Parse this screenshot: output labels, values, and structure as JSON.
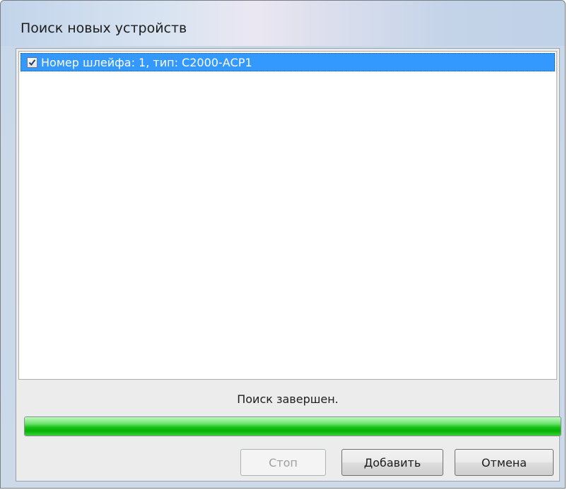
{
  "window": {
    "title": "Поиск новых устройств"
  },
  "list": {
    "items": [
      {
        "label": "Номер шлейфа: 1, тип: С2000-АСР1",
        "checked": true,
        "selected": true
      }
    ]
  },
  "status": {
    "text": "Поиск завершен.",
    "progress_fraction": 1.0
  },
  "buttons": {
    "stop_label": "Стоп",
    "stop_enabled": false,
    "add_label": "Добавить",
    "cancel_label": "Отмена"
  },
  "colors": {
    "selection": "#3399ff",
    "progress": "#19c219"
  },
  "icons": {
    "checkbox": "checkmark-icon"
  }
}
